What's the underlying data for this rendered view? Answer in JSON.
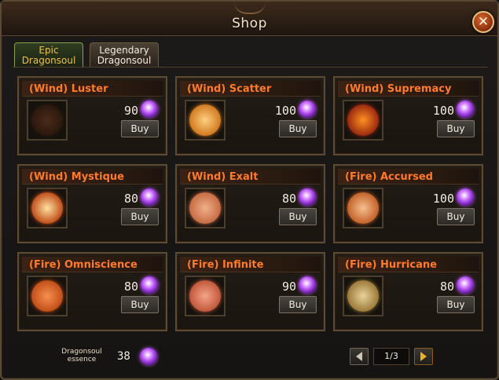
{
  "window": {
    "title": "Shop",
    "close_glyph": "✕"
  },
  "tabs": [
    {
      "label_line1": "Epic",
      "label_line2": "Dragonsoul",
      "active": true
    },
    {
      "label_line1": "Legendary",
      "label_line2": "Dragonsoul",
      "active": false
    }
  ],
  "items": [
    {
      "name": "(Wind) Luster",
      "price": "90",
      "buy_label": "Buy",
      "orb_colors": [
        "#4b2a1a",
        "#2a180d"
      ]
    },
    {
      "name": "(Wind) Scatter",
      "price": "100",
      "buy_label": "Buy",
      "orb_colors": [
        "#ffd080",
        "#d27a20"
      ]
    },
    {
      "name": "(Wind) Supremacy",
      "price": "100",
      "buy_label": "Buy",
      "orb_colors": [
        "#ff9020",
        "#9a2a10"
      ]
    },
    {
      "name": "(Wind) Mystique",
      "price": "80",
      "buy_label": "Buy",
      "orb_colors": [
        "#ffe0a0",
        "#c04f1a"
      ]
    },
    {
      "name": "(Wind) Exalt",
      "price": "80",
      "buy_label": "Buy",
      "orb_colors": [
        "#f0b08a",
        "#c76c44"
      ]
    },
    {
      "name": "(Fire) Accursed",
      "price": "100",
      "buy_label": "Buy",
      "orb_colors": [
        "#f6c090",
        "#c4622a"
      ]
    },
    {
      "name": "(Fire) Omniscience",
      "price": "80",
      "buy_label": "Buy",
      "orb_colors": [
        "#f89050",
        "#c14e18"
      ]
    },
    {
      "name": "(Fire) Infinite",
      "price": "90",
      "buy_label": "Buy",
      "orb_colors": [
        "#f6a38a",
        "#c0583a"
      ]
    },
    {
      "name": "(Fire) Hurricane",
      "price": "80",
      "buy_label": "Buy",
      "orb_colors": [
        "#e8d29a",
        "#9c7a3a"
      ]
    }
  ],
  "footer": {
    "essence_label_line1": "Dragonsoul",
    "essence_label_line2": "essence",
    "essence_value": "38",
    "page_indicator": "1/3"
  },
  "colors": {
    "item_name": "#ff7a2a",
    "active_tab_text": "#f0c040",
    "currency_gem": "#b04cf0"
  },
  "icons": {
    "currency": "purple-gem-icon",
    "close": "close-icon",
    "prev": "triangle-left-icon",
    "next": "triangle-right-icon"
  }
}
